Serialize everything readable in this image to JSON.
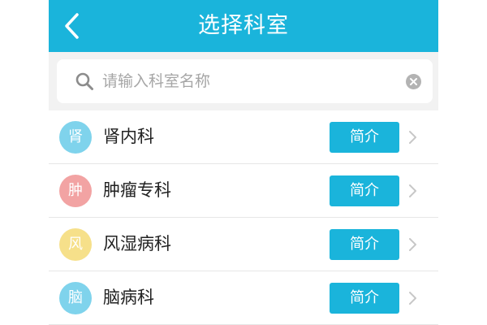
{
  "header": {
    "title": "选择科室",
    "back_icon": "chevron-left-icon",
    "background": "#1ab4db"
  },
  "search": {
    "placeholder": "请输入科室名称",
    "value": "",
    "icon": "search-icon",
    "clear_icon": "clear-icon"
  },
  "departments": [
    {
      "avatar_char": "肾",
      "name": "肾内科",
      "avatar_color": "#7fd3ec",
      "button_label": "简介"
    },
    {
      "avatar_char": "肿",
      "name": "肿瘤专科",
      "avatar_color": "#f2a3a3",
      "button_label": "简介"
    },
    {
      "avatar_char": "风",
      "name": "风湿病科",
      "avatar_color": "#f6e08a",
      "button_label": "简介"
    },
    {
      "avatar_char": "脑",
      "name": "脑病科",
      "avatar_color": "#7fd3ec",
      "button_label": "简介"
    }
  ],
  "colors": {
    "accent": "#1ab4db",
    "page_background": "#f2f2f2"
  }
}
